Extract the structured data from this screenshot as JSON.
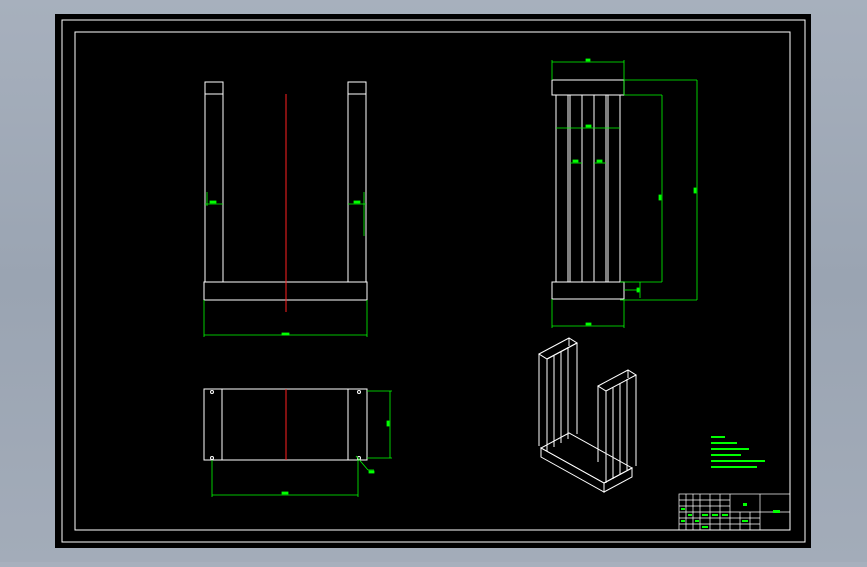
{
  "viewer": {
    "background": "#a3acb9",
    "paper_color": "#000000",
    "border_color": "#ffffff",
    "geometry_color": "#ffffff",
    "dimension_color": "#00ff00",
    "centerline_color": "#ff0000"
  },
  "drawing": {
    "views": [
      "front-view",
      "side-view",
      "top-view",
      "isometric-view"
    ],
    "dimension_text_legible": false,
    "notes_text_legible": false,
    "title_block_text_legible": false
  }
}
